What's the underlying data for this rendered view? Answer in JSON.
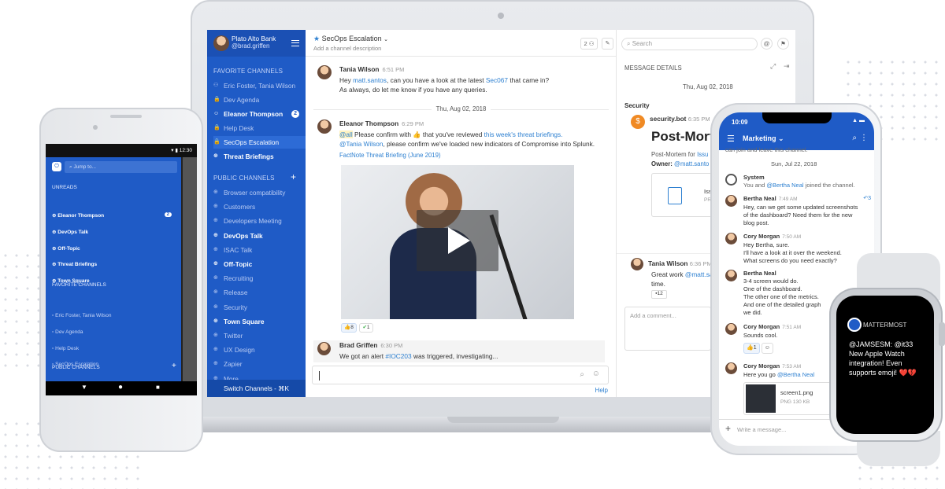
{
  "desktop": {
    "team": "Plato Alto Bank",
    "user": "@brad.griffen",
    "sections": {
      "favorites": "FAVORITE CHANNELS",
      "public": "PUBLIC CHANNELS"
    },
    "favorites": [
      {
        "label": "Eric Foster, Tania Wilson",
        "icon": "users-icon",
        "bold": false
      },
      {
        "label": "Dev Agenda",
        "icon": "lock-icon",
        "bold": false
      },
      {
        "label": "Eleanor Thompson",
        "icon": "user-icon",
        "bold": true,
        "badge": "2"
      },
      {
        "label": "Help Desk",
        "icon": "lock-icon",
        "bold": false
      },
      {
        "label": "SecOps Escalation",
        "icon": "lock-icon",
        "bold": false,
        "selected": true
      },
      {
        "label": "Threat Briefings",
        "icon": "globe-icon",
        "bold": true
      }
    ],
    "public": [
      {
        "label": "Browser compatibility",
        "bold": false
      },
      {
        "label": "Customers",
        "bold": false
      },
      {
        "label": "Developers Meeting",
        "bold": false
      },
      {
        "label": "DevOps Talk",
        "bold": true
      },
      {
        "label": "ISAC Talk",
        "bold": false
      },
      {
        "label": "Off-Topic",
        "bold": true
      },
      {
        "label": "Recruiting",
        "bold": false
      },
      {
        "label": "Release",
        "bold": false
      },
      {
        "label": "Security",
        "bold": false
      },
      {
        "label": "Town Square",
        "bold": true
      },
      {
        "label": "Twitter",
        "bold": false
      },
      {
        "label": "UX Design",
        "bold": false
      },
      {
        "label": "Zapier",
        "bold": false
      },
      {
        "label": "More...",
        "bold": false
      }
    ],
    "switch_channels": "Switch Channels - ⌘K",
    "channel_title": "SecOps Escalation",
    "channel_desc": "Add a channel description",
    "member_count": "2",
    "search_placeholder": "Search",
    "messages": {
      "m1": {
        "name": "Tania Wilson",
        "time": "6:51 PM",
        "l1a": "Hey ",
        "l1b": "matt.santos",
        "l1c": ", can you have a look at the latest ",
        "l1d": "Sec067",
        "l1e": " that came in?",
        "l2": "As always, do let me know if you have any queries."
      },
      "date1": "Thu, Aug 02, 2018",
      "m2": {
        "name": "Eleanor Thompson",
        "time": "6:29 PM",
        "l1a": "@all",
        "l1b": " Please confirm with ",
        "l1c": " that you've reviewed ",
        "l1d": "this week's threat briefings.",
        "l2a": "@Tania Wilson",
        "l2b": ", please confirm we've loaded new indicators of Compromise into Splunk.",
        "l3": "FactNote Threat Briefing (June 2019)",
        "r1": "8",
        "r2": "1"
      },
      "m3": {
        "name": "Brad Griffen",
        "time": "6:30 PM",
        "l1a": "We got an alert ",
        "l1b": "#IOC203",
        "l1c": " was triggered, investigating..."
      }
    },
    "help": "Help",
    "details": {
      "title": "MESSAGE DETAILS",
      "date": "Thu, Aug 02, 2018",
      "channel": "Security",
      "bot": "security.bot",
      "bot_time": "6:35 PM",
      "post_title": "Post-Mort",
      "post_line": "Post-Mortem for ",
      "post_link": "Issu",
      "owner_label": "Owner: ",
      "owner": "@matt.santo",
      "file_label": "Iss",
      "file_ext": "PR",
      "reply_name": "Tania Wilson",
      "reply_time": "6:36 PM",
      "reply_a": "Great work ",
      "reply_b": "@matt.sa",
      "reply_c": "time.",
      "reply_react": "12",
      "comment_placeholder": "Add a comment..."
    }
  },
  "android": {
    "time": "12:30",
    "search": "Jump to...",
    "sections": {
      "unreads": "UNREADS",
      "favorites": "FAVORITE CHANNELS",
      "public": "PUBLIC CHANNELS"
    },
    "unreads": [
      {
        "label": "Eleanor Thompson",
        "badge": "2"
      },
      {
        "label": "DevOps Talk"
      },
      {
        "label": "Off-Topic"
      },
      {
        "label": "Threat Briefings"
      },
      {
        "label": "Town Square"
      }
    ],
    "favorites": [
      "Eric Foster, Tania Wilson",
      "Dev Agenda",
      "Help Desk",
      "SecOps Escalation"
    ],
    "public": [
      "Browser compatibility"
    ]
  },
  "iphone": {
    "time": "10:09",
    "channel": "Marketing",
    "top_fragment": "can join and leave this channel.",
    "date": "Sun, Jul 22, 2018",
    "system_name": "System",
    "system_a": "You and ",
    "system_b": "@Bertha Neal",
    "system_c": " joined the channel.",
    "m1": {
      "name": "Bertha Neal",
      "time": "7:49 AM",
      "l1": "Hey, can we get some updated screenshots",
      "l2": "of the dashboard? Need them for the new",
      "l3": "blog post.",
      "replies": "3"
    },
    "m2": {
      "name": "Cory Morgan",
      "time": "7:50 AM",
      "l1": "Hey Bertha, sure.",
      "l2": "I'll have a look at it over the weekend.",
      "l3": "What screens do you need exactly?"
    },
    "m3": {
      "name": "Bertha Neal",
      "l1": "3-4 screen would do.",
      "l2": "One of the dashboard.",
      "l3": "The other one of the metrics.",
      "l4": "And one of the detailed graph",
      "l5": "we did."
    },
    "m4": {
      "name": "Cory Morgan",
      "time": "7:51 AM",
      "l1": "Sounds cool.",
      "react": "1"
    },
    "m5": {
      "name": "Cory Morgan",
      "time": "7:53 AM",
      "l1a": "Here you go ",
      "l1b": "@Bertha Neal",
      "file": "screen1.png",
      "file_meta": "PNG 130 KB"
    },
    "input_placeholder": "Write a message..."
  },
  "watch": {
    "brand": "MATTERMOST",
    "text": "@JAMSESM: @it33 New Apple Watch integration! Even supports emoji! ❤️💔"
  }
}
